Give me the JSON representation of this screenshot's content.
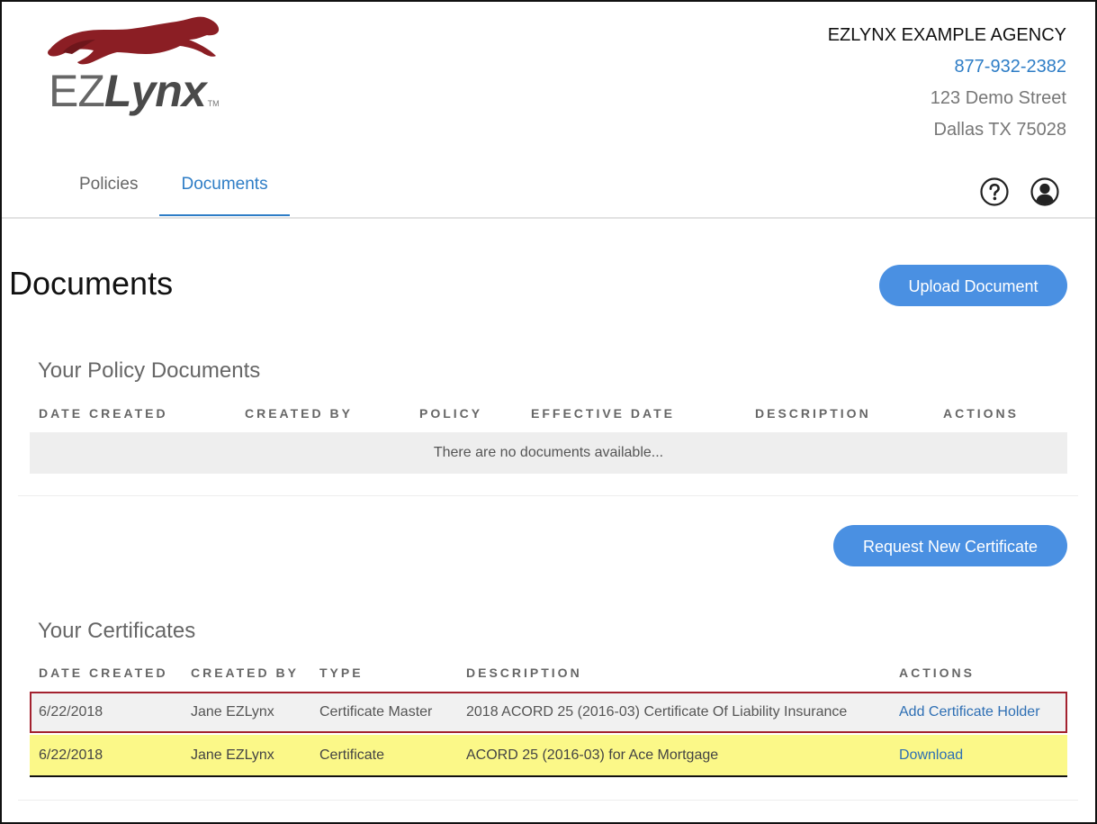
{
  "logo": {
    "ez": "EZ",
    "lynx": "Lynx",
    "tm": "TM"
  },
  "agency": {
    "name": "EZLYNX EXAMPLE AGENCY",
    "phone": "877-932-2382",
    "street": "123 Demo Street",
    "city": "Dallas TX 75028"
  },
  "nav": {
    "tabs": [
      {
        "label": "Policies",
        "active": false
      },
      {
        "label": "Documents",
        "active": true
      }
    ]
  },
  "icons": {
    "help": "help-circle-icon",
    "user": "user-account-icon"
  },
  "page": {
    "title": "Documents",
    "upload_button": "Upload Document"
  },
  "policy_documents": {
    "title": "Your Policy Documents",
    "columns": [
      "DATE CREATED",
      "CREATED BY",
      "POLICY",
      "EFFECTIVE DATE",
      "DESCRIPTION",
      "ACTIONS"
    ],
    "empty_message": "There are no documents available..."
  },
  "certificates": {
    "request_button": "Request New Certificate",
    "title": "Your Certificates",
    "columns": [
      "DATE CREATED",
      "CREATED BY",
      "TYPE",
      "DESCRIPTION",
      "ACTIONS"
    ],
    "rows": [
      {
        "date_created": "6/22/2018",
        "created_by": "Jane EZLynx",
        "type": "Certificate Master",
        "description": "2018 ACORD 25 (2016-03) Certificate Of Liability Insurance",
        "action": "Add Certificate Holder"
      },
      {
        "date_created": "6/22/2018",
        "created_by": "Jane EZLynx",
        "type": "Certificate",
        "description": "ACORD 25 (2016-03) for Ace Mortgage",
        "action": "Download"
      }
    ]
  },
  "colors": {
    "accent": "#2e7dc6",
    "button": "#4a90e2",
    "logo_cat": "#8b1e24",
    "highlight_row": "#fbf888",
    "selected_border": "#a3222f"
  }
}
